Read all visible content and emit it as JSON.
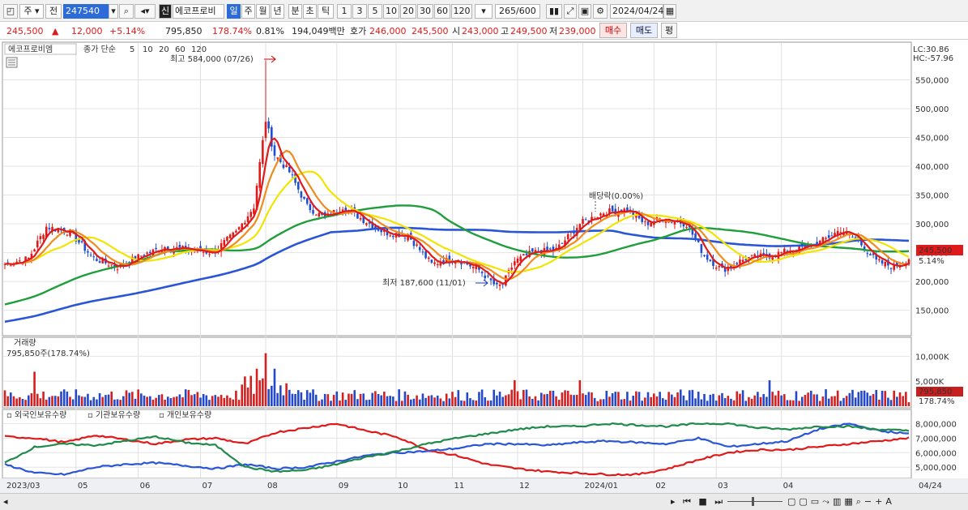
{
  "toolbar": {
    "period_label": "주",
    "prev_label": "전",
    "stock_code": "247540",
    "credit_badge": "신",
    "stock_name": "에코프로비",
    "tabs": [
      "일",
      "주",
      "월",
      "년",
      "분",
      "초",
      "틱"
    ],
    "active_tab": "일",
    "intervals": [
      "1",
      "3",
      "5",
      "10",
      "20",
      "30",
      "60",
      "120"
    ],
    "count": "265",
    "count_total": "/600",
    "date": "2024/04/24"
  },
  "quote": {
    "price": "245,500",
    "change_arrow": "▲",
    "change": "12,000",
    "change_pct": "+5.14%",
    "volume": "795,850",
    "volume_ratio": "178.74%",
    "turnover": "0.81%",
    "amount": "194,049백만",
    "ask_label": "호가",
    "ask": "246,000",
    "bid": "245,500",
    "open_label": "시",
    "open": "243,000",
    "high_label": "고",
    "high": "249,500",
    "low_label": "저",
    "low": "239,000",
    "buy_button": "매수",
    "sell_button": "매도",
    "eval_button": "평"
  },
  "panels": {
    "price_legend": {
      "name": "에코프로비엠",
      "series_label": "종가 단순",
      "ma": [
        {
          "label": "5",
          "color": "#e01a1a"
        },
        {
          "label": "10",
          "color": "#f08c1e"
        },
        {
          "label": "20",
          "color": "#f2e400"
        },
        {
          "label": "60",
          "color": "#1f9e3a"
        },
        {
          "label": "120",
          "color": "#2a56d6"
        }
      ]
    },
    "lc": "LC:30.86",
    "hc": "HC:-57.96",
    "current_price_tag": "245,500",
    "current_pct_tag": "5.14%",
    "high_note": "최고 584,000 (07/26)",
    "low_note": "최저 187,600 (11/01)",
    "dividend_note": "배당락(0.00%)",
    "volume_title": "거래량",
    "volume_value": "795,850주(178.74%)",
    "volume_tag": "795,850",
    "volume_tag_pct": "178.74%",
    "holding_legend": [
      {
        "label": "외국인보유수량",
        "color": "#e01a1a"
      },
      {
        "label": "기관보유수량",
        "color": "#2a56d6"
      },
      {
        "label": "개인보유수량",
        "color": "#1f8a4a"
      }
    ]
  },
  "chart_data": [
    {
      "type": "candlestick",
      "title": "에코프로비엠",
      "ylim": [
        110000,
        600000
      ],
      "ticks": [
        "150,000",
        "200,000",
        "250,000",
        "300,000",
        "350,000",
        "400,000",
        "450,000",
        "500,000",
        "550,000"
      ],
      "x_labels": [
        "2023/03",
        "05",
        "06",
        "07",
        "08",
        "09",
        "10",
        "11",
        "12",
        "2024/01",
        "02",
        "03",
        "04",
        "04/24"
      ],
      "close_path": [
        [
          0,
          230000
        ],
        [
          8,
          240000
        ],
        [
          14,
          295000
        ],
        [
          22,
          285000
        ],
        [
          30,
          240000
        ],
        [
          38,
          225000
        ],
        [
          46,
          245000
        ],
        [
          54,
          260000
        ],
        [
          62,
          255000
        ],
        [
          70,
          250000
        ],
        [
          78,
          285000
        ],
        [
          84,
          330000
        ],
        [
          88,
          480000
        ],
        [
          91,
          420000
        ],
        [
          96,
          390000
        ],
        [
          102,
          330000
        ],
        [
          108,
          310000
        ],
        [
          114,
          330000
        ],
        [
          120,
          310000
        ],
        [
          128,
          285000
        ],
        [
          136,
          280000
        ],
        [
          144,
          230000
        ],
        [
          152,
          240000
        ],
        [
          160,
          220000
        ],
        [
          166,
          190000
        ],
        [
          168,
          195000
        ],
        [
          172,
          235000
        ],
        [
          178,
          250000
        ],
        [
          186,
          255000
        ],
        [
          194,
          300000
        ],
        [
          202,
          320000
        ],
        [
          210,
          325000
        ],
        [
          216,
          300000
        ],
        [
          222,
          310000
        ],
        [
          230,
          300000
        ],
        [
          236,
          245000
        ],
        [
          242,
          220000
        ],
        [
          250,
          240000
        ],
        [
          258,
          245000
        ],
        [
          266,
          255000
        ],
        [
          274,
          265000
        ],
        [
          282,
          290000
        ],
        [
          288,
          270000
        ],
        [
          294,
          235000
        ],
        [
          300,
          225000
        ],
        [
          305,
          240000
        ]
      ],
      "extremes": {
        "high": 584000,
        "low": 187600
      },
      "moving_averages": [
        "5",
        "10",
        "20",
        "60",
        "120"
      ]
    },
    {
      "type": "bar",
      "title": "거래량",
      "ticks": [
        "5,000K",
        "10,000K"
      ],
      "ylim": [
        0,
        12000000
      ],
      "last_value": 795850
    },
    {
      "type": "line",
      "series": [
        {
          "name": "외국인보유수량",
          "color": "#e01a1a",
          "values": [
            7100000,
            7000000,
            6700000,
            7200000,
            6900000,
            6600000,
            6900000,
            7000000,
            6600000,
            7400000,
            7700000,
            8000000,
            7500000,
            7100000,
            6200000,
            5800000,
            5200000,
            4900000,
            4700000,
            4600000,
            4500000,
            4500000,
            4900000,
            5500000,
            6000000,
            6200000,
            6200000,
            6400000,
            6600000,
            6800000,
            7000000
          ]
        },
        {
          "name": "기관보유수량",
          "color": "#2a56d6",
          "values": [
            5200000,
            4600000,
            4500000,
            5000000,
            5200000,
            5300000,
            5100000,
            4900000,
            5200000,
            4900000,
            5000000,
            5400000,
            5800000,
            6000000,
            6100000,
            6300000,
            6600000,
            6600000,
            6500000,
            6700000,
            6800000,
            6700000,
            6600000,
            7000000,
            6400000,
            6600000,
            6800000,
            7600000,
            8000000,
            7500000,
            7300000
          ]
        },
        {
          "name": "개인보유수량",
          "color": "#1f8a4a",
          "values": [
            5300000,
            6400000,
            6600000,
            6500000,
            6800000,
            7100000,
            6700000,
            6500000,
            5000000,
            4700000,
            4800000,
            5200000,
            5700000,
            6100000,
            6600000,
            7000000,
            7300000,
            7600000,
            7800000,
            7800000,
            8000000,
            7900000,
            7800000,
            8000000,
            8000000,
            7700000,
            7600000,
            7800000,
            7800000,
            7600000,
            7500000
          ]
        }
      ],
      "ticks": [
        "5,000,000",
        "6,000,000",
        "7,000,000",
        "8,000,000"
      ],
      "ylim": [
        4400000,
        8300000
      ]
    }
  ]
}
